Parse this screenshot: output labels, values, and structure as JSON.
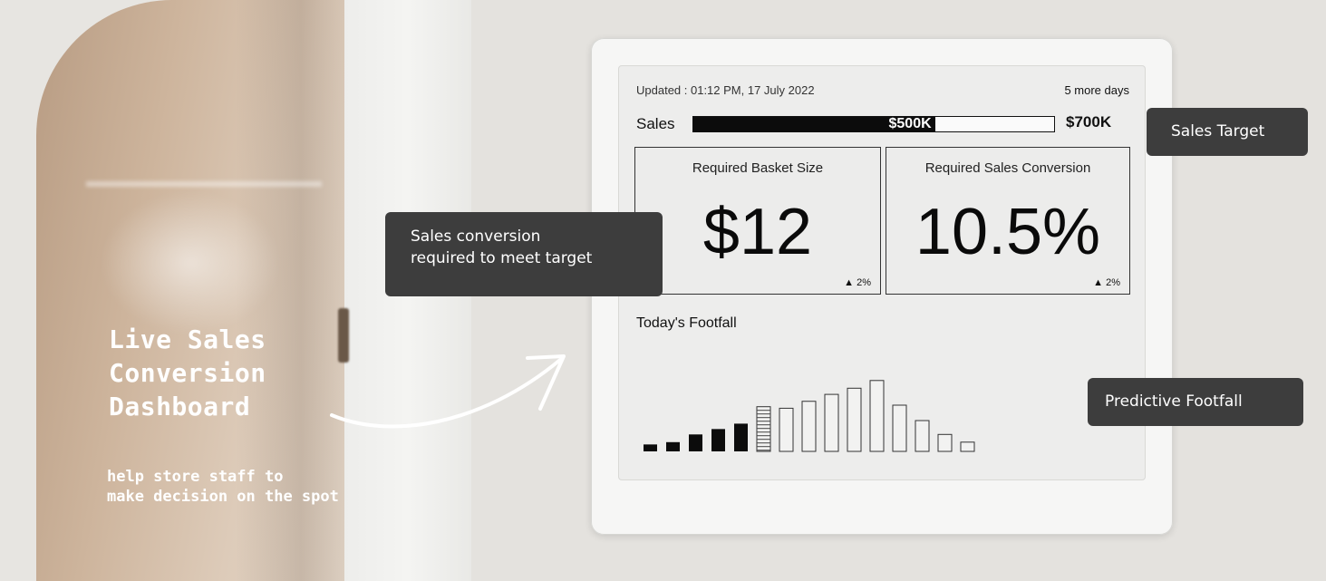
{
  "left_panel": {
    "headline_lines": [
      "Live Sales",
      "Conversion",
      "Dashboard"
    ],
    "sub_lines": [
      "help store staff to",
      "make decision on the spot"
    ]
  },
  "device": {
    "updated_text": "Updated : 01:12 PM, 17 July 2022",
    "days_left": "5 more days",
    "sales": {
      "label": "Sales",
      "current": "$500K",
      "target": "$700K",
      "progress_fraction": 0.67
    },
    "cards": [
      {
        "title": "Required Basket Size",
        "value": "$12",
        "delta": "▲ 2%"
      },
      {
        "title": "Required Sales Conversion",
        "value": "10.5%",
        "delta": "▲ 2%"
      }
    ],
    "footfall": {
      "label": "Today's Footfall",
      "bars": [
        {
          "level": 0.09,
          "style": "actual"
        },
        {
          "level": 0.12,
          "style": "actual"
        },
        {
          "level": 0.22,
          "style": "actual"
        },
        {
          "level": 0.29,
          "style": "actual"
        },
        {
          "level": 0.36,
          "style": "actual"
        },
        {
          "level": 0.58,
          "style": "current"
        },
        {
          "level": 0.56,
          "style": "predicted"
        },
        {
          "level": 0.65,
          "style": "predicted"
        },
        {
          "level": 0.74,
          "style": "predicted"
        },
        {
          "level": 0.82,
          "style": "predicted"
        },
        {
          "level": 0.92,
          "style": "predicted"
        },
        {
          "level": 0.6,
          "style": "predicted"
        },
        {
          "level": 0.4,
          "style": "predicted"
        },
        {
          "level": 0.22,
          "style": "predicted"
        },
        {
          "level": 0.12,
          "style": "predicted"
        }
      ]
    }
  },
  "callouts": {
    "conversion_lines": [
      "Sales conversion",
      "required to meet target"
    ],
    "sales_target": "Sales Target",
    "predictive_footfall": "Predictive Footfall"
  },
  "colors": {
    "callout_bg": "#3d3d3d",
    "bar_fill": "#0c0c0c",
    "screen_bg": "#ededec"
  }
}
